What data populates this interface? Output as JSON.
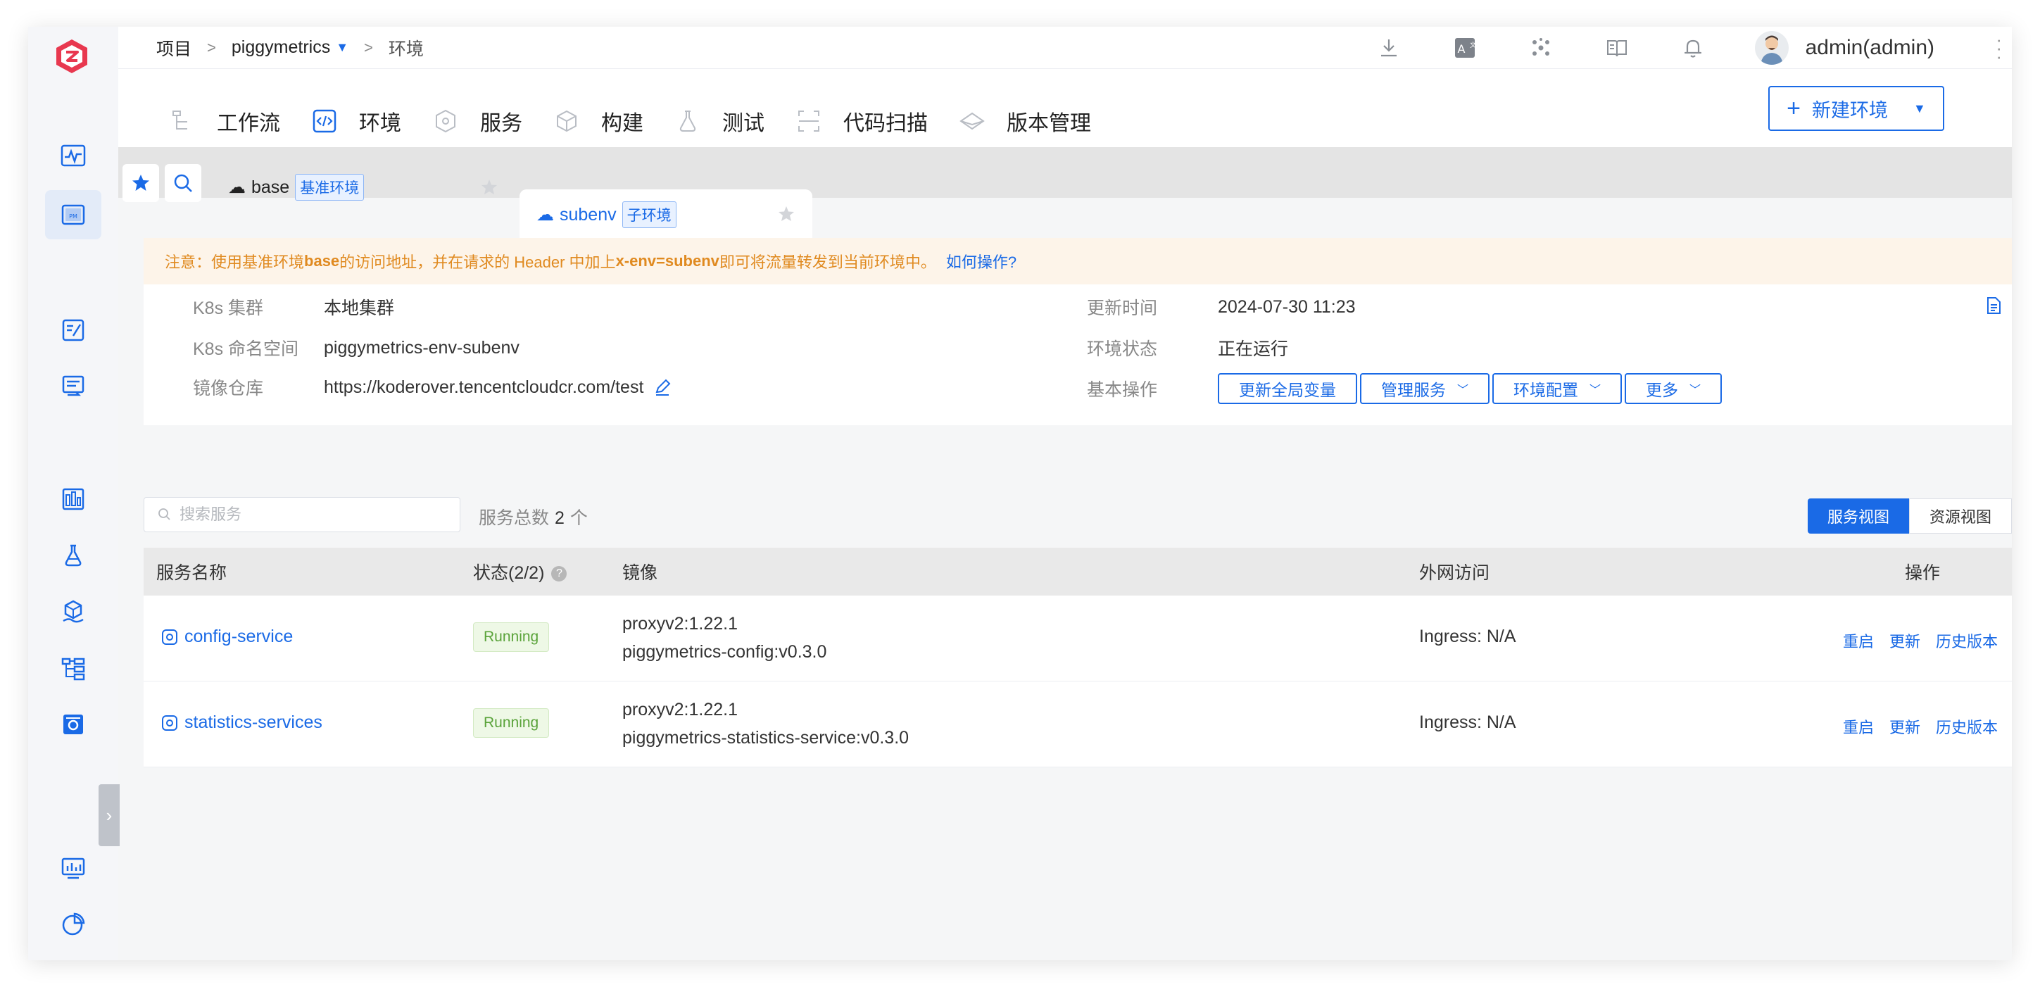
{
  "breadcrumb": {
    "project": "项目",
    "project_name": "piggymetrics",
    "current": "环境",
    "sep": ">"
  },
  "user": {
    "name": "admin(admin)"
  },
  "nav": {
    "tabs": [
      {
        "label": "工作流",
        "icon": "workflow-icon"
      },
      {
        "label": "环境",
        "icon": "environment-icon"
      },
      {
        "label": "服务",
        "icon": "service-icon"
      },
      {
        "label": "构建",
        "icon": "build-icon"
      },
      {
        "label": "测试",
        "icon": "test-icon"
      },
      {
        "label": "代码扫描",
        "icon": "scan-icon"
      },
      {
        "label": "版本管理",
        "icon": "version-icon"
      }
    ],
    "new_env_label": "新建环境"
  },
  "env_tabs": [
    {
      "name": "base",
      "badge": "基准环境"
    },
    {
      "name": "subenv",
      "badge": "子环境"
    }
  ],
  "notice": {
    "prefix": "注意：使用基准环境 ",
    "env": "base",
    "middle": " 的访问地址，并在请求的 Header 中加上 ",
    "header": "x-env=subenv",
    "suffix": " 即可将流量转发到当前环境中。",
    "link": "如何操作?"
  },
  "info": {
    "cluster_label": "K8s 集群",
    "cluster_value": "本地集群",
    "namespace_label": "K8s 命名空间",
    "namespace_value": "piggymetrics-env-subenv",
    "registry_label": "镜像仓库",
    "registry_value": "https://koderover.tencentcloudcr.com/test",
    "updated_label": "更新时间",
    "updated_value": "2024-07-30 11:23",
    "status_label": "环境状态",
    "status_value": "正在运行",
    "ops_label": "基本操作",
    "ops": [
      "更新全局变量",
      "管理服务",
      "环境配置",
      "更多"
    ]
  },
  "services": {
    "search_placeholder": "搜索服务",
    "count_label": "服务总数",
    "count": "2",
    "count_unit": "个",
    "view_service": "服务视图",
    "view_resource": "资源视图"
  },
  "table": {
    "headers": {
      "name": "服务名称",
      "status": "状态(2/2)",
      "image": "镜像",
      "access": "外网访问",
      "ops": "操作"
    },
    "rows": [
      {
        "name": "config-service",
        "status": "Running",
        "image1": "proxyv2:1.22.1",
        "image2": "piggymetrics-config:v0.3.0",
        "access": "Ingress: N/A",
        "a1": "重启",
        "a2": "更新",
        "a3": "历史版本"
      },
      {
        "name": "statistics-services",
        "status": "Running",
        "image1": "proxyv2:1.22.1",
        "image2": "piggymetrics-statistics-service:v0.3.0",
        "access": "Ingress: N/A",
        "a1": "重启",
        "a2": "更新",
        "a3": "历史版本"
      }
    ]
  },
  "colors": {
    "accent": "#1a6ae6",
    "notice_text": "#e08a20",
    "logo": "#e8384f",
    "running": "#5aa33a"
  }
}
